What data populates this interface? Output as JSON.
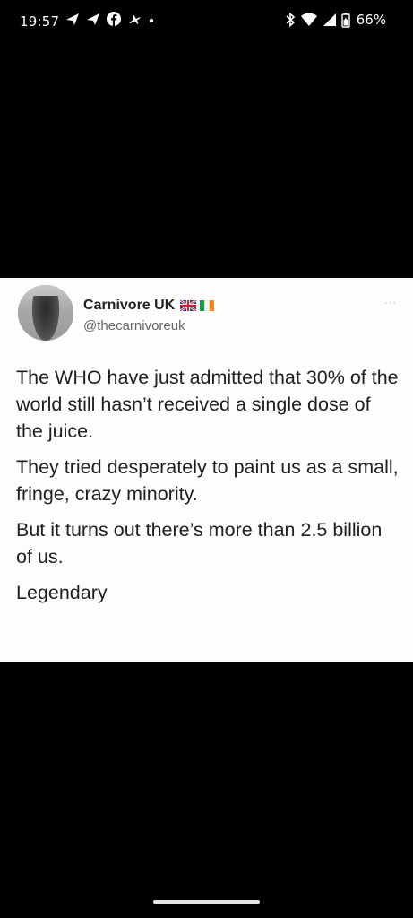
{
  "status_bar": {
    "time": "19:57",
    "left_icons": [
      "navigation-arrow-icon",
      "navigation-arrow-icon",
      "facebook-icon",
      "airplane-icon",
      "dot-icon"
    ],
    "right_icons": [
      "bluetooth-icon",
      "wifi-icon",
      "cell-signal-icon",
      "battery-icon"
    ],
    "battery_percent": "66%"
  },
  "tweet": {
    "author_name": "Carnivore UK",
    "author_handle": "@thecarnivoreuk",
    "flags": [
      "uk-flag-icon",
      "ireland-flag-icon"
    ],
    "more_label": "···",
    "paragraphs": [
      "The WHO have just admitted that 30% of the world still hasn’t received a single dose of the juice.",
      "They tried desperately to paint us as a small, fringe, crazy minority.",
      "But it turns out there’s more than 2.5 billion of us.",
      "Legendary"
    ]
  },
  "colors": {
    "background": "#000000",
    "card_background": "#fdfdfd",
    "text_primary": "#1f1f1f",
    "text_secondary": "#666666"
  }
}
